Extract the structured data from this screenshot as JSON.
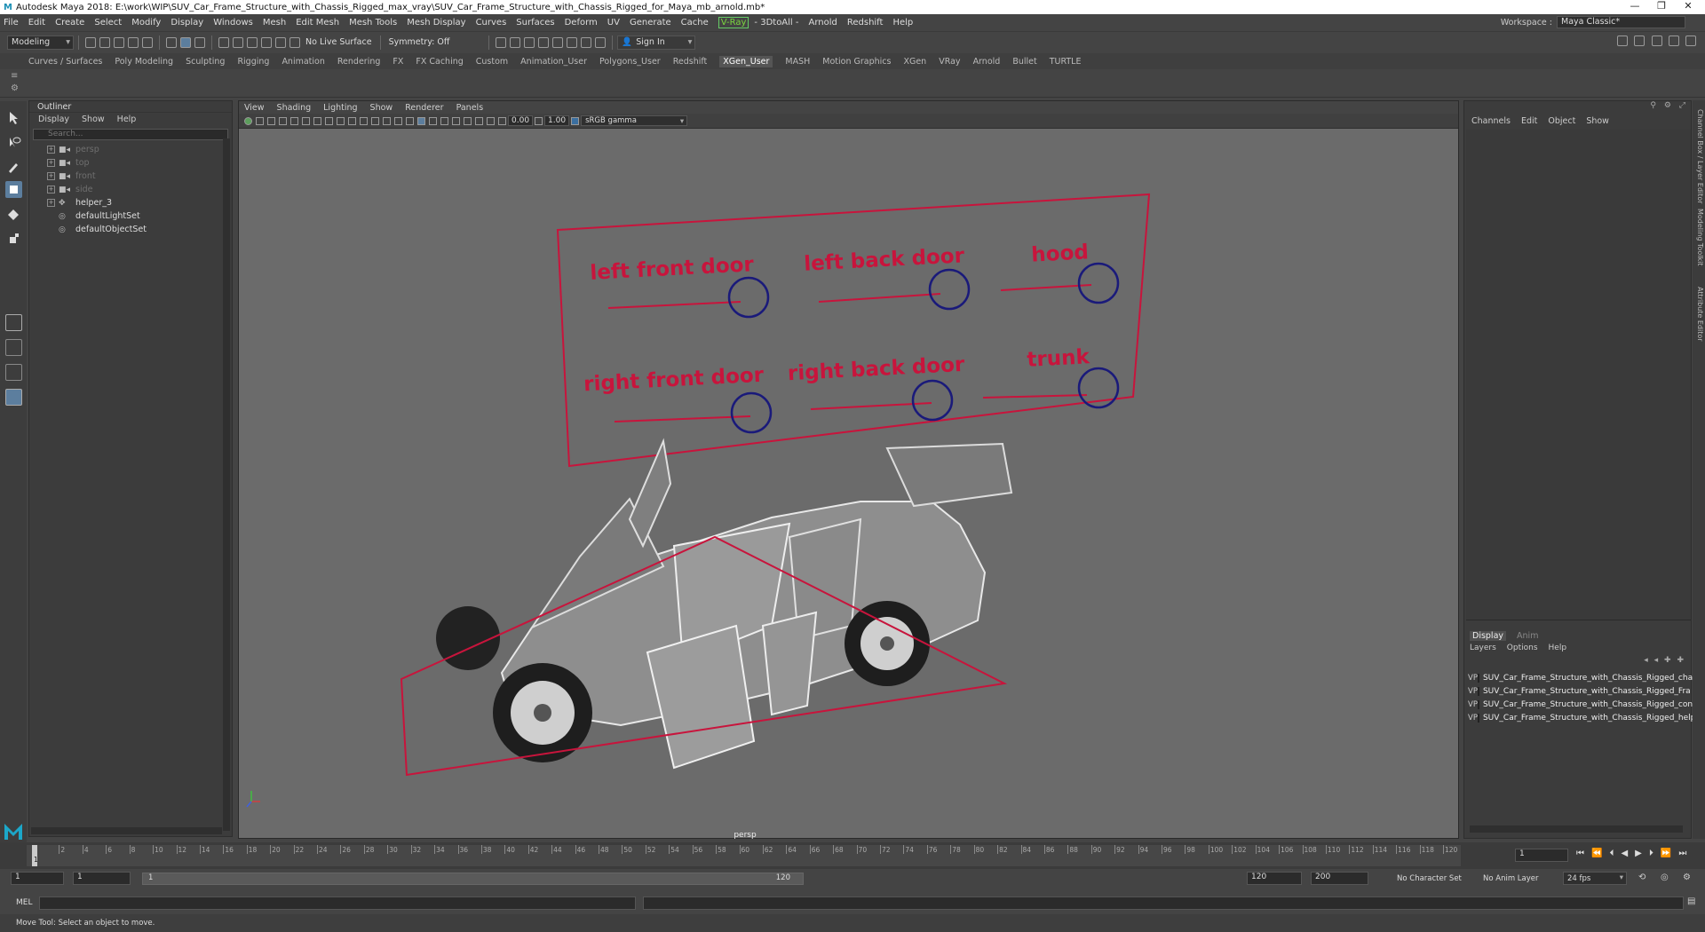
{
  "title_bar": {
    "app_title": "Autodesk Maya 2018: E:\\work\\WIP\\SUV_Car_Frame_Structure_with_Chassis_Rigged_max_vray\\SUV_Car_Frame_Structure_with_Chassis_Rigged_for_Maya_mb_arnold.mb*",
    "logo": "M"
  },
  "menu": {
    "items": [
      "File",
      "Edit",
      "Create",
      "Select",
      "Modify",
      "Display",
      "Windows",
      "Mesh",
      "Edit Mesh",
      "Mesh Tools",
      "Mesh Display",
      "Curves",
      "Surfaces",
      "Deform",
      "UV",
      "Generate",
      "Cache"
    ],
    "vray": "V-Ray",
    "after": [
      "- 3DtoAll -",
      "Arnold",
      "Redshift",
      "Help"
    ]
  },
  "workspace": {
    "label": "Workspace :",
    "value": "Maya Classic*"
  },
  "status_line": {
    "mode": "Modeling",
    "live_surface": "No Live Surface",
    "symmetry": "Symmetry: Off",
    "sign_in": "Sign In"
  },
  "shelf_tabs": {
    "items": [
      "Curves / Surfaces",
      "Poly Modeling",
      "Sculpting",
      "Rigging",
      "Animation",
      "Rendering",
      "FX",
      "FX Caching",
      "Custom",
      "Animation_User",
      "Polygons_User",
      "Redshift",
      "XGen_User",
      "MASH",
      "Motion Graphics",
      "XGen",
      "VRay",
      "Arnold",
      "Bullet",
      "TURTLE"
    ],
    "active": "XGen_User"
  },
  "outliner": {
    "title": "Outliner",
    "menu": [
      "Display",
      "Show",
      "Help"
    ],
    "search_placeholder": "Search...",
    "items": [
      {
        "label": "persp",
        "dim": true
      },
      {
        "label": "top",
        "dim": true
      },
      {
        "label": "front",
        "dim": true
      },
      {
        "label": "side",
        "dim": true
      },
      {
        "label": "helper_3",
        "dim": false
      },
      {
        "label": "defaultLightSet",
        "dim": false
      },
      {
        "label": "defaultObjectSet",
        "dim": false
      }
    ]
  },
  "viewport": {
    "menu": [
      "View",
      "Shading",
      "Lighting",
      "Show",
      "Renderer",
      "Panels"
    ],
    "exposure": "0.00",
    "gamma": "1.00",
    "color_space": "sRGB gamma",
    "camera_label": "persp",
    "controls": [
      "left front door",
      "left back door",
      "hood",
      "right front door",
      "right back door",
      "trunk"
    ],
    "rig_color": "#c8143c",
    "handle_color": "#1a1a7a"
  },
  "channel_box": {
    "menu": [
      "Channels",
      "Edit",
      "Object",
      "Show"
    ]
  },
  "layer_editor": {
    "tabs": [
      "Display",
      "Anim"
    ],
    "active_tab": "Display",
    "menu": [
      "Layers",
      "Options",
      "Help"
    ],
    "layers": [
      {
        "v": "V",
        "p": "P",
        "name": "SUV_Car_Frame_Structure_with_Chassis_Rigged_chas",
        "color": "#1e5b1e"
      },
      {
        "v": "V",
        "p": "P",
        "name": "SUV_Car_Frame_Structure_with_Chassis_Rigged_Fra",
        "color": "#1010e0"
      },
      {
        "v": "V",
        "p": "P",
        "name": "SUV_Car_Frame_Structure_with_Chassis_Rigged_contr",
        "color": "#151560"
      },
      {
        "v": "V",
        "p": "P",
        "name": "SUV_Car_Frame_Structure_with_Chassis_Rigged_help",
        "color": "#a0102c"
      }
    ]
  },
  "side_tabs": [
    "Channel Box / Layer Editor",
    "Modeling Toolkit",
    "Attribute Editor"
  ],
  "time_slider": {
    "ticks": [
      "2",
      "4",
      "6",
      "8",
      "10",
      "12",
      "14",
      "16",
      "18",
      "20",
      "22",
      "24",
      "26",
      "28",
      "30",
      "32",
      "34",
      "36",
      "38",
      "40",
      "42",
      "44",
      "46",
      "48",
      "50",
      "52",
      "54",
      "56",
      "58",
      "60",
      "62",
      "64",
      "66",
      "68",
      "70",
      "72",
      "74",
      "76",
      "78",
      "80",
      "82",
      "84",
      "86",
      "88",
      "90",
      "92",
      "94",
      "96",
      "98",
      "100",
      "102",
      "104",
      "106",
      "108",
      "110",
      "112",
      "114",
      "116",
      "118",
      "120"
    ],
    "current_frame": "1",
    "current_field": "1"
  },
  "range": {
    "start": "1",
    "start2": "1",
    "range_start": "1",
    "range_end": "120",
    "end": "120",
    "max": "200",
    "character_set": "No Character Set",
    "anim_layer": "No Anim Layer",
    "fps": "24 fps"
  },
  "command_line": {
    "label": "MEL"
  },
  "help_line": {
    "text": "Move Tool: Select an object to move."
  }
}
